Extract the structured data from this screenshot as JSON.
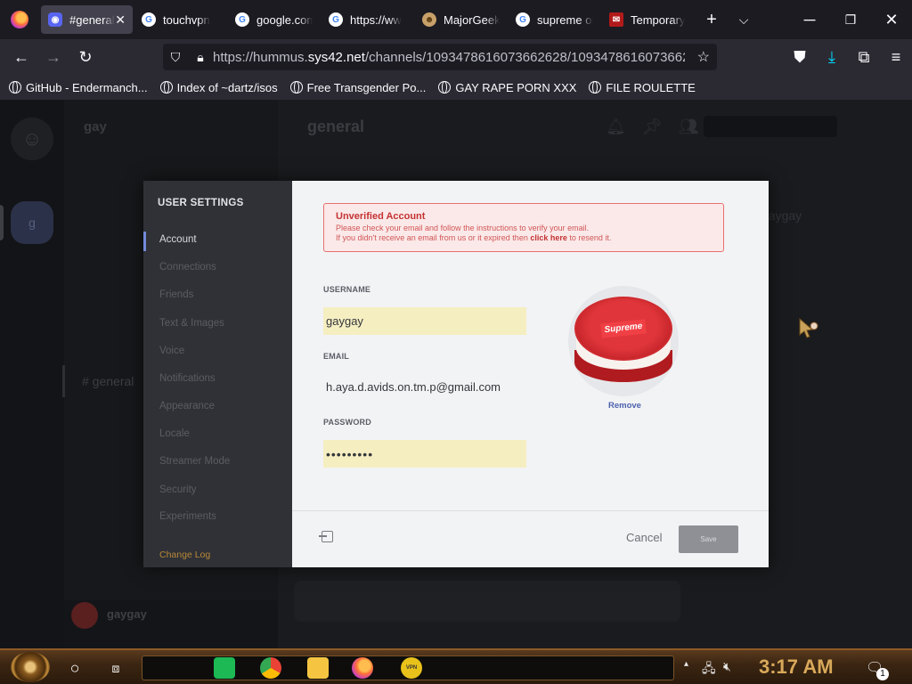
{
  "browser": {
    "tabs": [
      {
        "label": "#general",
        "icon": "discord-icon",
        "active": true
      },
      {
        "label": "touchvpn",
        "icon": "google-icon"
      },
      {
        "label": "google.com",
        "icon": "google-icon"
      },
      {
        "label": "https://ww",
        "icon": "google-icon"
      },
      {
        "label": "MajorGeeks",
        "icon": "majorgeeks-icon"
      },
      {
        "label": "supreme oreo",
        "icon": "google-icon"
      },
      {
        "label": "Temporary",
        "icon": "mail-icon"
      }
    ],
    "tab_close": "✕",
    "new_tab": "+",
    "url_prefix": "https://hummus.",
    "url_domain": "sys42.net",
    "url_path": "/channels/1093478616073662628/1093478616073662",
    "bookmarks": [
      "GitHub - Endermanch...",
      "Index of ~dartz/isos",
      "Free Transgender Po...",
      "GAY RAPE PORN XXX",
      "FILE ROULETTE"
    ]
  },
  "discord_bg": {
    "server_name": "gay",
    "channel_header": "general",
    "channel_item": "# general",
    "member_name": "gaygay",
    "message_author": "gaygay",
    "user_panel_name": "gaygay"
  },
  "settings": {
    "title": "USER SETTINGS",
    "nav": [
      "Account",
      "Connections",
      "Friends",
      "Text & Images",
      "Voice",
      "Notifications",
      "Appearance",
      "Locale",
      "Streamer Mode",
      "Security",
      "Experiments"
    ],
    "change_log": "Change Log",
    "alert": {
      "title": "Unverified Account",
      "line1": "Please check your email and follow the instructions to verify your email.",
      "line2_pre": "If you didn't receive an email from us or it expired then ",
      "line2_link": "click here",
      "line2_post": " to resend it."
    },
    "username_label": "USERNAME",
    "username_value": "gaygay",
    "email_label": "EMAIL",
    "email_value": "h.aya.d.avids.on.tm.p@gmail.com",
    "password_label": "PASSWORD",
    "password_value": "•••••••••",
    "avatar_text": "Supreme",
    "remove_label": "Remove",
    "cancel_label": "Cancel",
    "save_label": "Save"
  },
  "taskbar": {
    "time": "3:17 AM",
    "apps": [
      "spotify-icon",
      "chrome-icon",
      "file-explorer-icon",
      "firefox-icon",
      "vpn-pro-icon"
    ],
    "vpn_label": "VPN PRO",
    "notification_count": "1"
  },
  "colors": {
    "accent": "#7289da",
    "alert_red": "#c43232",
    "taskbar_gold": "#d9a95a"
  }
}
